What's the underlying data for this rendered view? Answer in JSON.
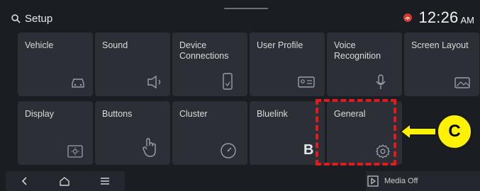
{
  "header": {
    "title": "Setup",
    "time": "12:26",
    "ampm": "AM"
  },
  "tiles": [
    {
      "label": "Vehicle",
      "icon": "car-icon"
    },
    {
      "label": "Sound",
      "icon": "speaker-icon"
    },
    {
      "label": "Device\nConnections",
      "icon": "phone-icon"
    },
    {
      "label": "User Profile",
      "icon": "profile-card-icon"
    },
    {
      "label": "Voice\nRecognition",
      "icon": "microphone-icon"
    },
    {
      "label": "Screen Layout",
      "icon": "image-icon"
    },
    {
      "label": "Display",
      "icon": "brightness-icon"
    },
    {
      "label": "Buttons",
      "icon": "touch-hand-icon"
    },
    {
      "label": "Cluster",
      "icon": "gauge-icon"
    },
    {
      "label": "Bluelink",
      "icon": "bluelink-icon",
      "icon_text": "B"
    },
    {
      "label": "General",
      "icon": "gear-icon"
    }
  ],
  "nav": {
    "items": [
      "back-icon",
      "home-icon",
      "menu-icon"
    ]
  },
  "media": {
    "label": "Media Off"
  },
  "annotation": {
    "label": "C",
    "color": "#e01b1b",
    "badge_color": "#fff200"
  }
}
